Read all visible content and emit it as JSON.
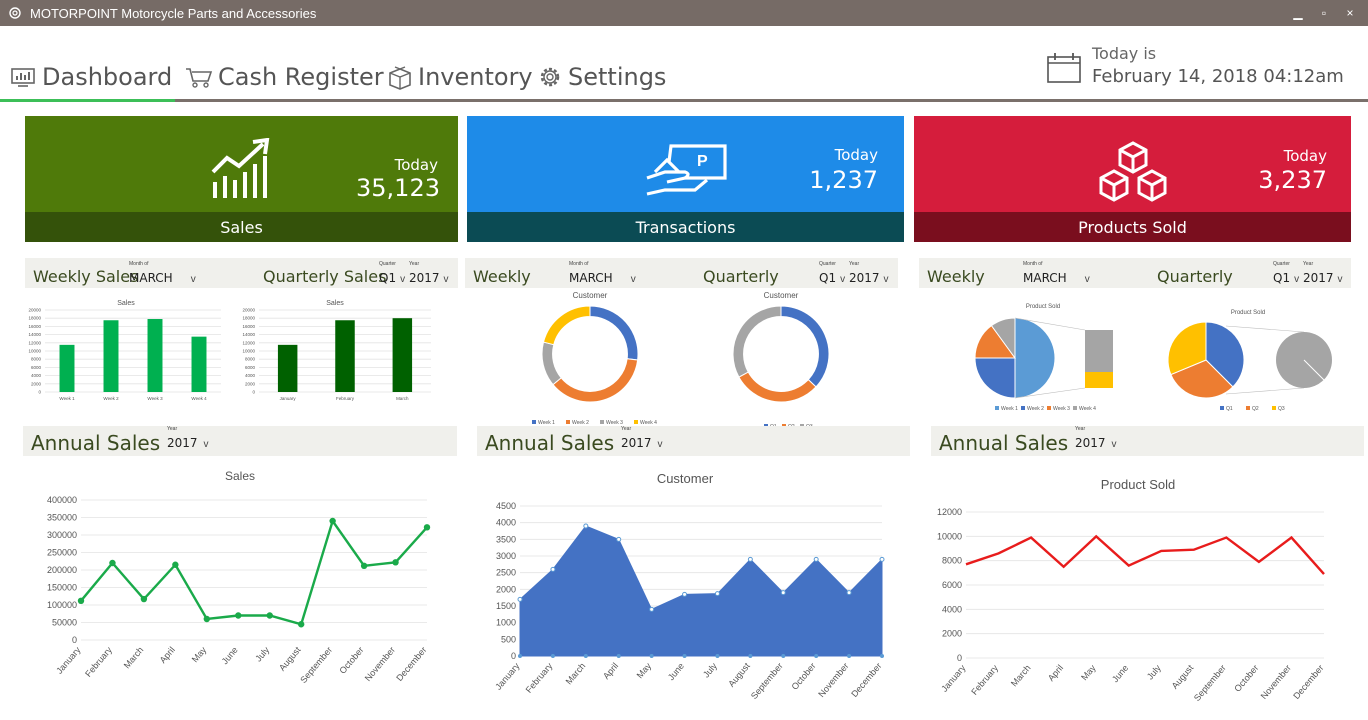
{
  "window": {
    "title": "MOTORPOINT Motorcycle Parts and Accessories",
    "min": "▁",
    "max": "▫",
    "close": "×"
  },
  "nav": {
    "tabs": [
      {
        "label": "Dashboard",
        "icon": "monitor-chart-icon",
        "active": true
      },
      {
        "label": "Cash Register",
        "icon": "cart-icon"
      },
      {
        "label": "Inventory",
        "icon": "box-icon"
      },
      {
        "label": "Settings",
        "icon": "gear-icon"
      }
    ],
    "today_label": "Today is",
    "today_date": "February 14, 2018 04:12am"
  },
  "colors": {
    "sales": "#4f7a0a",
    "sales_dark": "#34520a",
    "transactions": "#1e8be8",
    "transactions_dark": "#0b4b54",
    "products": "#d51d3c",
    "products_dark": "#7a0e1e",
    "accent_tab": "#3cbf58"
  },
  "cards": {
    "sales": {
      "label": "Sales",
      "today": "Today",
      "value": "35,123"
    },
    "transactions": {
      "label": "Transactions",
      "today": "Today",
      "value": "1,237"
    },
    "products": {
      "label": "Products Sold",
      "today": "Today",
      "value": "3,237"
    }
  },
  "panels": {
    "sales": {
      "weekly": "Weekly Sales",
      "quarterly": "Quarterly Sales",
      "month_cap": "Month of",
      "month": "MARCH",
      "quarter_cap": "Quarter",
      "quarter": "Q1",
      "year_cap": "Year",
      "year": "2017"
    },
    "transactions": {
      "weekly": "Weekly",
      "quarterly": "Quarterly",
      "month_cap": "Month of",
      "month": "MARCH",
      "quarter_cap": "Quarter",
      "quarter": "Q1",
      "year_cap": "Year",
      "year": "2017"
    },
    "products": {
      "weekly": "Weekly",
      "quarterly": "Quarterly",
      "month_cap": "Month of",
      "month": "MARCH",
      "quarter_cap": "Quarter",
      "quarter": "Q1",
      "year_cap": "Year",
      "year": "2017"
    }
  },
  "annual": {
    "label": "Annual Sales",
    "year_cap": "Year",
    "year": "2017"
  },
  "chart_data": [
    {
      "id": "weekly-sales",
      "type": "bar",
      "title": "Sales",
      "categories": [
        "Week 1",
        "Week 2",
        "Week 3",
        "Week 4"
      ],
      "values": [
        11500,
        17500,
        17800,
        13500
      ],
      "ylim": [
        0,
        20000
      ],
      "yticks": [
        "0",
        "2000",
        "4000",
        "6000",
        "8000",
        "10000",
        "12000",
        "14000",
        "16000",
        "18000",
        "20000"
      ],
      "color": "#00b050"
    },
    {
      "id": "quarterly-sales",
      "type": "bar",
      "title": "Sales",
      "categories": [
        "January",
        "February",
        "March"
      ],
      "values": [
        11500,
        17500,
        18000
      ],
      "ylim": [
        0,
        20000
      ],
      "yticks": [
        "0",
        "2000",
        "4000",
        "6000",
        "8000",
        "10000",
        "12000",
        "14000",
        "16000",
        "18000",
        "20000"
      ],
      "color": "#006100"
    },
    {
      "id": "weekly-customer",
      "type": "pie",
      "title": "Customer",
      "categories": [
        "Week 1",
        "Week 2",
        "Week 3",
        "Week 4"
      ],
      "values": [
        27,
        37,
        15,
        21
      ],
      "colors": [
        "#4472c4",
        "#ed7d31",
        "#a5a5a5",
        "#ffc000"
      ],
      "donut": true
    },
    {
      "id": "quarterly-customer",
      "type": "pie",
      "title": "Customer",
      "categories": [
        "Q1",
        "Q2",
        "Q3"
      ],
      "values": [
        37,
        30,
        33
      ],
      "colors": [
        "#4472c4",
        "#ed7d31",
        "#a5a5a5"
      ],
      "donut": true
    },
    {
      "id": "weekly-product",
      "type": "pie",
      "title": "Product Sold",
      "categories": [
        "Week 1",
        "Week 2",
        "Week 3",
        "Week 4"
      ],
      "values": [
        50,
        25,
        15,
        10
      ],
      "colors": [
        "#5b9bd5",
        "#4472c4",
        "#ed7d31",
        "#a5a5a5"
      ]
    },
    {
      "id": "quarterly-product",
      "type": "pie",
      "title": "Product Sold",
      "categories": [
        "Q1",
        "Q2",
        "Q3"
      ],
      "values": [
        30,
        25,
        25
      ],
      "colors": [
        "#4472c4",
        "#ed7d31",
        "#ffc000"
      ]
    },
    {
      "id": "annual-sales",
      "type": "line",
      "title": "Sales",
      "categories": [
        "January",
        "February",
        "March",
        "April",
        "May",
        "June",
        "July",
        "August",
        "September",
        "October",
        "November",
        "December"
      ],
      "values": [
        112000,
        220000,
        117000,
        215000,
        60000,
        70000,
        70000,
        45000,
        340000,
        212000,
        222000,
        322000
      ],
      "ylim": [
        0,
        400000
      ],
      "yticks": [
        "0",
        "50000",
        "100000",
        "150000",
        "200000",
        "250000",
        "300000",
        "350000",
        "400000"
      ],
      "color": "#1aaa4a"
    },
    {
      "id": "annual-customer",
      "type": "area",
      "title": "Customer",
      "categories": [
        "January",
        "February",
        "March",
        "April",
        "May",
        "June",
        "July",
        "August",
        "September",
        "October",
        "November",
        "December"
      ],
      "values": [
        1700,
        2600,
        3900,
        3500,
        1400,
        1850,
        1870,
        2900,
        1900,
        2900,
        1900,
        2900
      ],
      "ylim": [
        0,
        4500
      ],
      "yticks": [
        "0",
        "500",
        "1000",
        "1500",
        "2000",
        "2500",
        "3000",
        "3500",
        "4000",
        "4500"
      ],
      "color": "#4472c4"
    },
    {
      "id": "annual-product",
      "type": "line",
      "title": "Product Sold",
      "categories": [
        "January",
        "February",
        "March",
        "April",
        "May",
        "June",
        "July",
        "August",
        "September",
        "October",
        "November",
        "December"
      ],
      "values": [
        7700,
        8600,
        9900,
        7500,
        10000,
        7600,
        8800,
        8900,
        9900,
        7900,
        9900,
        6900
      ],
      "ylim": [
        0,
        12000
      ],
      "yticks": [
        "0",
        "2000",
        "4000",
        "6000",
        "8000",
        "10000",
        "12000"
      ],
      "color": "#e81c1c"
    }
  ]
}
